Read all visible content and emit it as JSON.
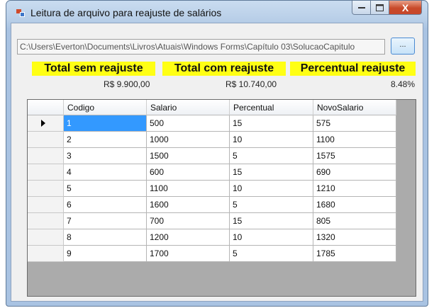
{
  "window": {
    "title": "Leitura de arquivo para reajuste de salários",
    "close_label": "X"
  },
  "file": {
    "path": "C:\\Users\\Everton\\Documents\\Livros\\Atuais\\Windows Forms\\Capítulo 03\\SolucaoCapitulo",
    "browse_label": "..."
  },
  "summary": {
    "total_sem_label": "Total sem reajuste",
    "total_com_label": "Total com reajuste",
    "percentual_label": "Percentual reajuste",
    "total_sem_value": "R$ 9.900,00",
    "total_com_value": "R$ 10.740,00",
    "percentual_value": "8.48%"
  },
  "grid": {
    "columns": [
      "Codigo",
      "Salario",
      "Percentual",
      "NovoSalario"
    ],
    "rows": [
      [
        "1",
        "500",
        "15",
        "575"
      ],
      [
        "2",
        "1000",
        "10",
        "1100"
      ],
      [
        "3",
        "1500",
        "5",
        "1575"
      ],
      [
        "4",
        "600",
        "15",
        "690"
      ],
      [
        "5",
        "1100",
        "10",
        "1210"
      ],
      [
        "6",
        "1600",
        "5",
        "1680"
      ],
      [
        "7",
        "700",
        "15",
        "805"
      ],
      [
        "8",
        "1200",
        "10",
        "1320"
      ],
      [
        "9",
        "1700",
        "5",
        "1785"
      ]
    ],
    "selected_row": 0
  }
}
